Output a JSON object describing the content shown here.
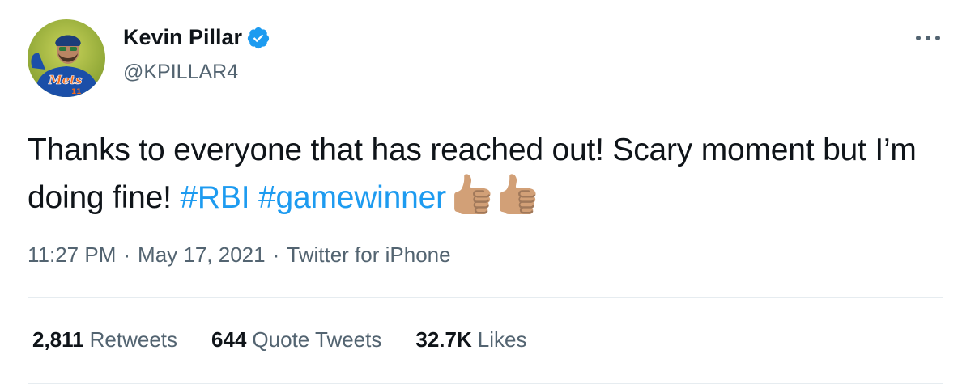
{
  "author": {
    "display_name": "Kevin Pillar",
    "handle": "@KPILLAR4",
    "verified": true,
    "avatar_jersey_text": "Mets",
    "avatar_jersey_number": "11"
  },
  "tweet": {
    "text_part1": "Thanks to everyone that has reached out! Scary moment but I’m doing fine! ",
    "hashtags": [
      "#RBI",
      "#gamewinner"
    ],
    "emojis": [
      "thumbs-up-medium-light-skin",
      "thumbs-up-medium-light-skin"
    ]
  },
  "meta": {
    "time": "11:27 PM",
    "date": "May 17, 2021",
    "source": "Twitter for iPhone",
    "separator": "·"
  },
  "stats": [
    {
      "count": "2,811",
      "label": "Retweets"
    },
    {
      "count": "644",
      "label": "Quote Tweets"
    },
    {
      "count": "32.7K",
      "label": "Likes"
    }
  ],
  "icons": {
    "verified": "verified-badge-icon",
    "more": "more-options-icon"
  },
  "colors": {
    "hashtag": "#1d9bf0",
    "verified": "#1d9bf0",
    "secondary_text": "#536471",
    "primary_text": "#0f1419",
    "divider": "#e6ecf0"
  }
}
